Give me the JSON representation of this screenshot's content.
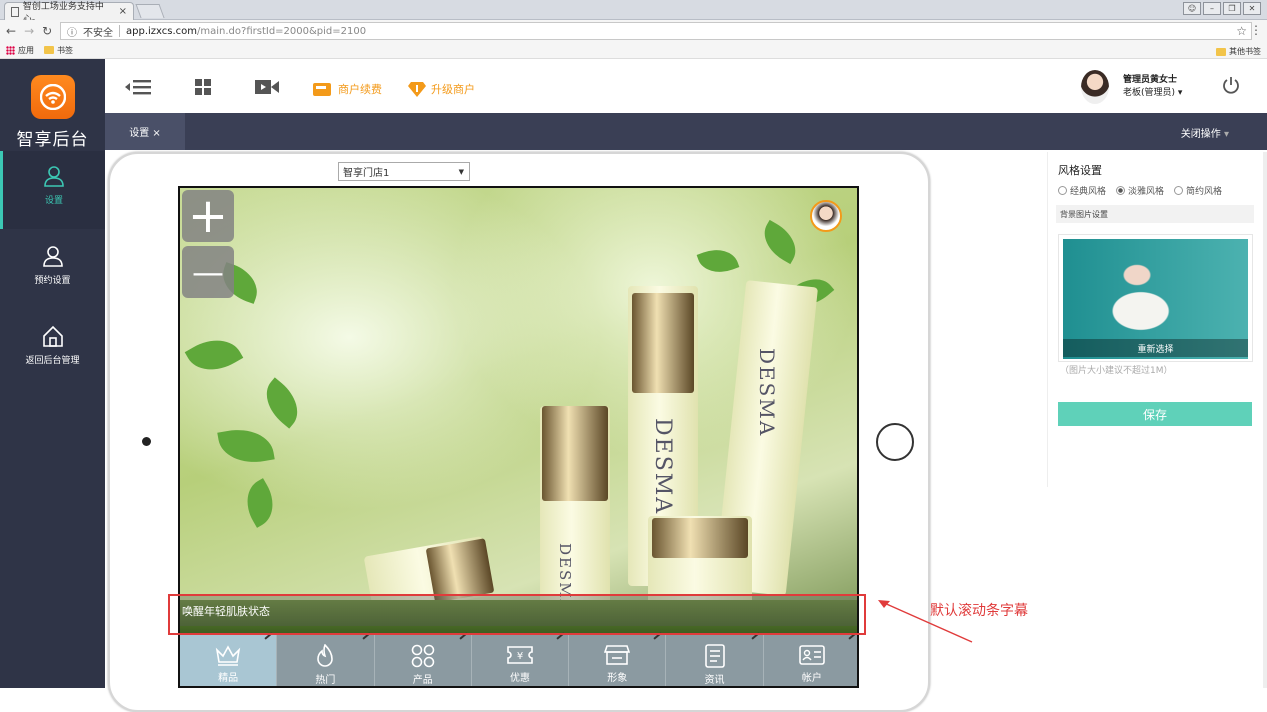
{
  "browser": {
    "tab_title": "智创工场业务支持中心-",
    "tab_close": "×",
    "insecure_label": "不安全",
    "url_host": "app.izxcs.com",
    "url_path": "/main.do?firstId=2000&pid=2100",
    "bookmarks": {
      "apps": "应用",
      "bookmarks": "书签",
      "other": "其他书签"
    }
  },
  "sidebar": {
    "brand": "智享后台",
    "items": [
      {
        "label": "设置"
      },
      {
        "label": "预约设置"
      },
      {
        "label": "返回后台管理"
      }
    ]
  },
  "topbar": {
    "renew": "商户续费",
    "upgrade": "升级商户",
    "user_name": "管理员黄女士",
    "user_role": "老板(管理员)"
  },
  "tabs": {
    "active": "设置 ×",
    "close_ops": "关闭操作"
  },
  "preview": {
    "store": "智享门店1",
    "zoom_in": "+",
    "zoom_out": "—",
    "marquee": "唤醒年轻肌肤状态",
    "brand_text": "DESMA",
    "nav": [
      {
        "label": "精品",
        "icon": "crown-icon"
      },
      {
        "label": "热门",
        "icon": "fire-icon"
      },
      {
        "label": "产品",
        "icon": "grid-icon"
      },
      {
        "label": "优惠",
        "icon": "coupon-icon"
      },
      {
        "label": "形象",
        "icon": "store-icon"
      },
      {
        "label": "资讯",
        "icon": "news-icon"
      },
      {
        "label": "帐户",
        "icon": "id-card-icon"
      }
    ]
  },
  "annotation": {
    "callout": "默认滚动条字幕",
    "color": "#e03b3b"
  },
  "panel": {
    "style_title": "风格设置",
    "styles": [
      "经典风格",
      "淡雅风格",
      "简约风格"
    ],
    "selected_style": "淡雅风格",
    "bg_title": "背景图片设置",
    "reselect": "重新选择",
    "hint": "（图片大小建议不超过1M）",
    "save": "保存"
  },
  "colors": {
    "accent": "#3cc8b4",
    "orange": "#f39a1a",
    "sidebar": "#2f3447",
    "save": "#5fd1b9"
  }
}
